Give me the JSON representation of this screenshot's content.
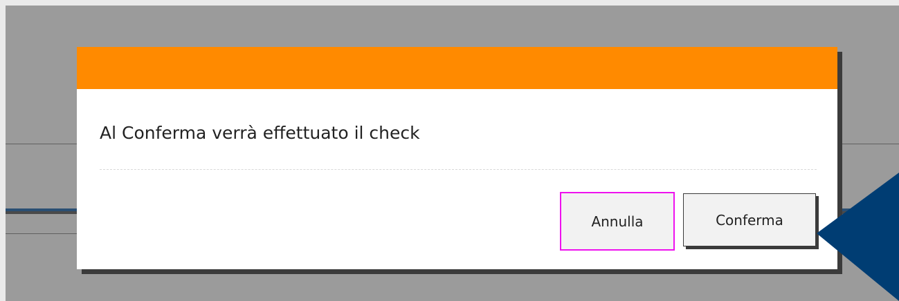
{
  "dialog": {
    "message": "Al Conferma verrà effettuato il check",
    "cancel_label": "Annulla",
    "confirm_label": "Conferma",
    "header_color": "#ff8a00"
  },
  "annotations": {
    "cancel_highlight_color": "#ee11ee",
    "pointer_arrow_color": "#003d73"
  }
}
